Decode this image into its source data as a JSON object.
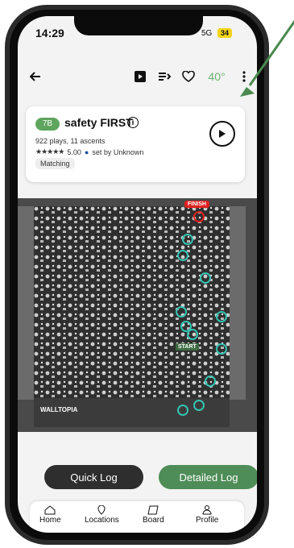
{
  "status": {
    "time": "14:29",
    "network": "5G",
    "battery": "34"
  },
  "toolbar": {
    "back_icon": "back-icon",
    "icons": [
      "video-icon",
      "queue-icon",
      "heart-icon"
    ],
    "temperature": "40°",
    "more_icon": "more-icon"
  },
  "climb": {
    "grade": "7B",
    "name": "safety FIRST",
    "stats": "922 plays, 11 ascents",
    "rating": "5.00",
    "setter": "set by Unknown",
    "tag": "Matching"
  },
  "board": {
    "finish_label": "FINISH",
    "start_label": "START",
    "logo_text": "WALLTOPIA"
  },
  "actions": {
    "quick_log": "Quick Log",
    "detailed_log": "Detailed Log"
  },
  "nav": {
    "items": [
      {
        "label": "Home",
        "icon": "home-icon"
      },
      {
        "label": "Locations",
        "icon": "location-icon"
      },
      {
        "label": "Board",
        "icon": "board-icon"
      },
      {
        "label": "Profile",
        "icon": "profile-icon"
      }
    ]
  },
  "colors": {
    "accent": "#5fa55e",
    "finish": "#e02020",
    "hold": "#34c3b2"
  }
}
